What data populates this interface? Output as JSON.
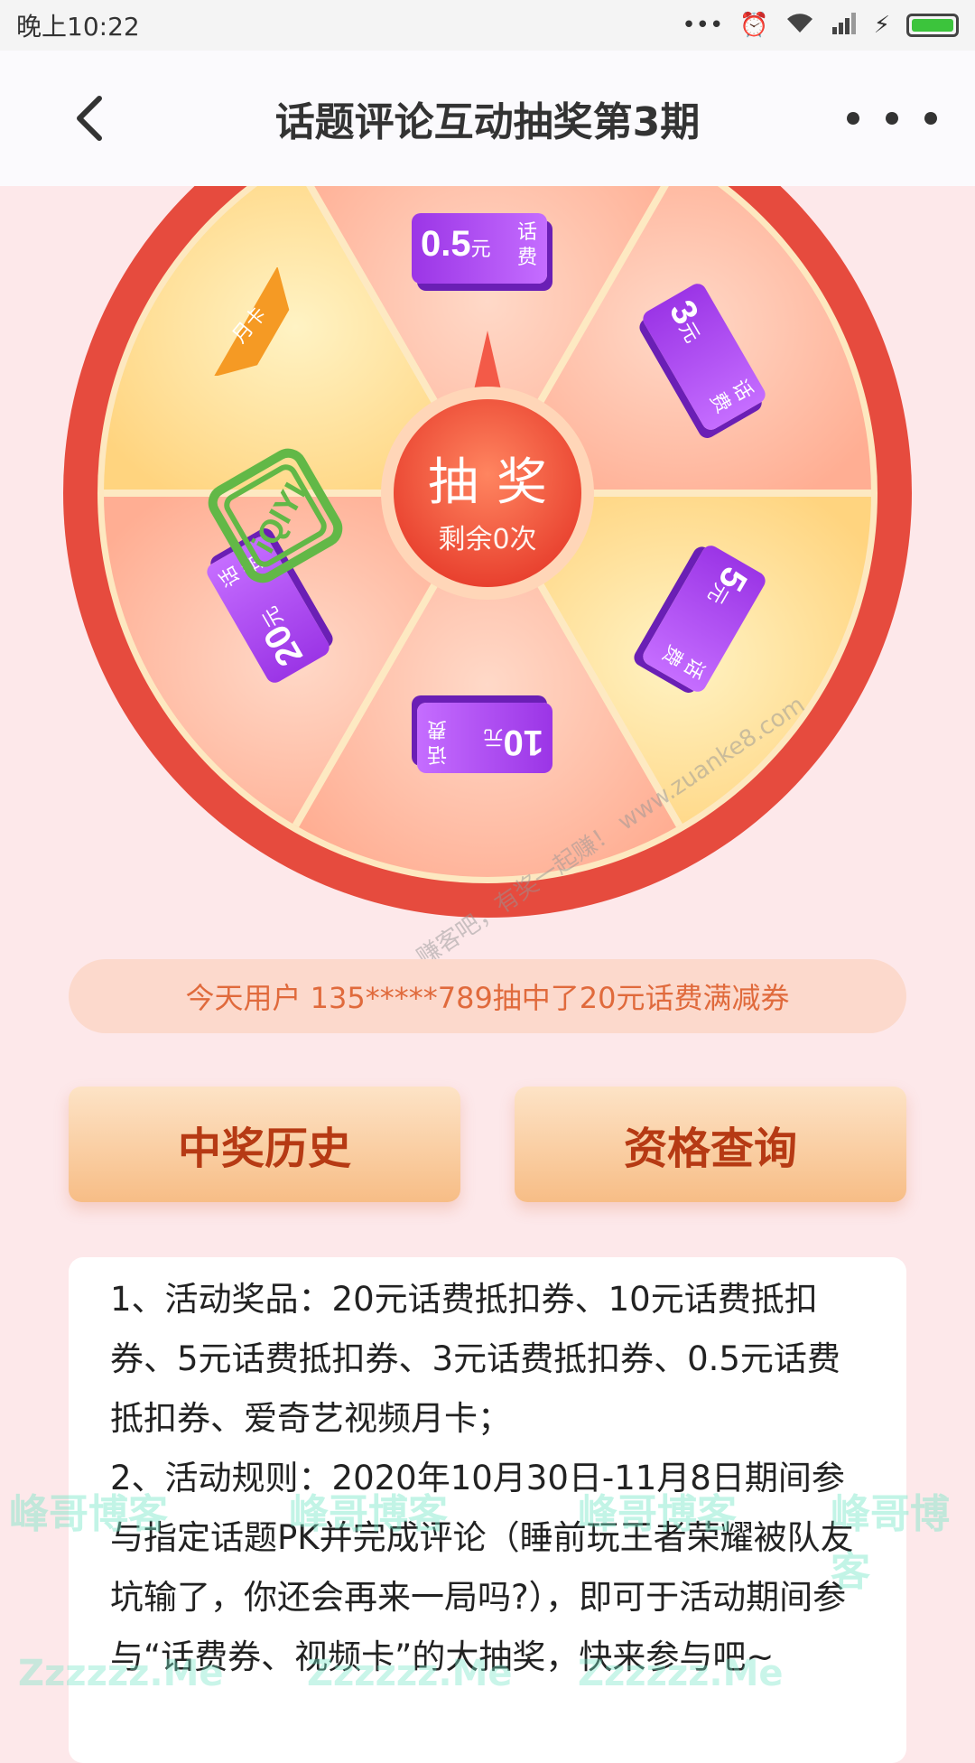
{
  "status_bar": {
    "time": "晚上10:22",
    "icons": [
      "more-dots-icon",
      "alarm-icon",
      "wifi-icon",
      "hd-signal-icon",
      "charging-icon",
      "battery-icon"
    ]
  },
  "header": {
    "title": "话题评论互动抽奖第3期",
    "back_icon": "chevron-left-icon",
    "more_icon": "more-horizontal-icon"
  },
  "wheel": {
    "spin_label": "抽奖",
    "remaining": "剩余0次",
    "prizes": [
      {
        "amount": "0.5",
        "unit": "元",
        "tag": "话费"
      },
      {
        "amount": "3",
        "unit": "元",
        "tag": "话费"
      },
      {
        "amount": "5",
        "unit": "元",
        "tag": "话费"
      },
      {
        "amount": "10",
        "unit": "元",
        "tag": "话费"
      },
      {
        "amount": "20",
        "unit": "元",
        "tag": "话费"
      },
      {
        "badge": "月卡",
        "logo": "iQIYI"
      }
    ]
  },
  "winner_banner": "今天用户 135*****789抽中了20元话费满减券",
  "buttons": {
    "history": "中奖历史",
    "qualify": "资格查询"
  },
  "rules": [
    "1、活动奖品：20元话费抵扣券、10元话费抵扣券、5元话费抵扣券、3元话费抵扣券、0.5元话费抵扣券、爱奇艺视频月卡；",
    "2、活动规则：2020年10月30日-11月8日期间参与指定话题PK并完成评论（睡前玩王者荣耀被队友坑输了，你还会再来一局吗?），即可于活动期间参与“话费券、视频卡”的大抽奖，快来参与吧~"
  ],
  "watermarks": {
    "site_diag": "赚客吧，有奖一起赚！ www.zuanke8.com",
    "brand": "峰哥博客",
    "brand_url": "Zzzzzz.Me"
  }
}
